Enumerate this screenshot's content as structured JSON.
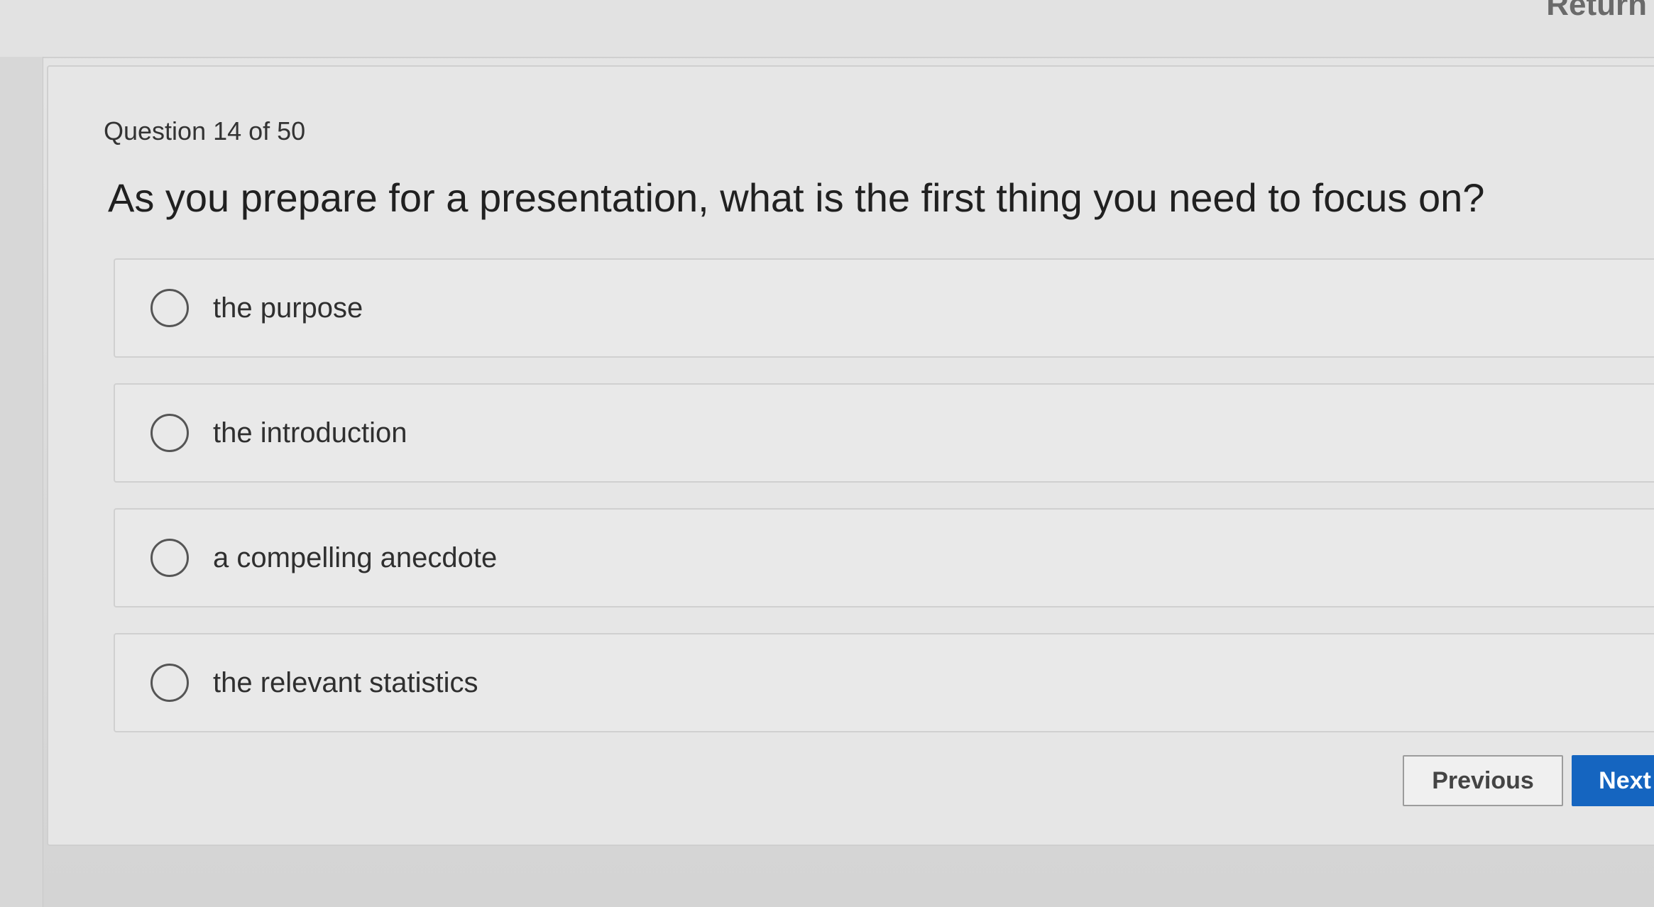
{
  "header": {
    "return_label": "Return"
  },
  "quiz": {
    "counter": "Question 14 of 50",
    "question": "As you prepare for a presentation, what is the first thing you need to focus on?",
    "options": [
      {
        "label": "the purpose",
        "selected": false
      },
      {
        "label": "the introduction",
        "selected": false
      },
      {
        "label": "a compelling anecdote",
        "selected": false
      },
      {
        "label": "the relevant statistics",
        "selected": false
      }
    ]
  },
  "navigation": {
    "previous_label": "Previous",
    "next_label": "Next"
  },
  "colors": {
    "accent": "#1565c0",
    "background": "#dcdcdc",
    "card": "#e6e6e6"
  }
}
